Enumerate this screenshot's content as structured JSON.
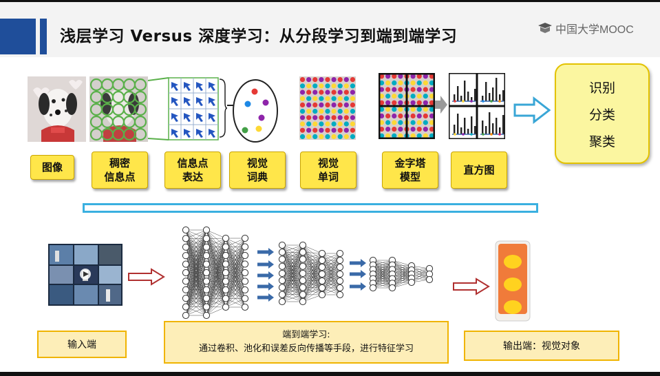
{
  "slide": {
    "title": "浅层学习 Versus 深度学习：从分段学习到端到端学习",
    "logo": "中国大学MOOC"
  },
  "pipeline": [
    {
      "label": "图像"
    },
    {
      "label": "稠密\n信息点"
    },
    {
      "label": "信息点\n表达"
    },
    {
      "label": "视觉\n词典"
    },
    {
      "label": "视觉\n单词"
    },
    {
      "label": "金字塔\n模型"
    },
    {
      "label": "直方图"
    }
  ],
  "result": [
    "识别",
    "分类",
    "聚类"
  ],
  "bottom": {
    "input_label": "输入端",
    "middle_title": "端到端学习:",
    "middle_desc": "通过卷积、池化和误差反向传播等手段，进行特征学习",
    "output_label": "输出端：视觉对象"
  },
  "colors": {
    "header_bar": "#1f4e9a",
    "label_fill": "#ffe64a",
    "result_fill": "#fbf6a0",
    "divider": "#3ab0e0",
    "bottom_fill": "#fdeeb8",
    "arrow_red": "#c0392b",
    "arrow_blue": "#3a6aa8",
    "output_orange": "#f07b3a"
  },
  "icons": [
    "dalmatian-image",
    "grid-image",
    "feature-patches",
    "dictionary-ellipse",
    "visual-words-image",
    "pyramid-grid",
    "histogram-grid",
    "video-thumbnail",
    "neural-network",
    "output-object"
  ]
}
